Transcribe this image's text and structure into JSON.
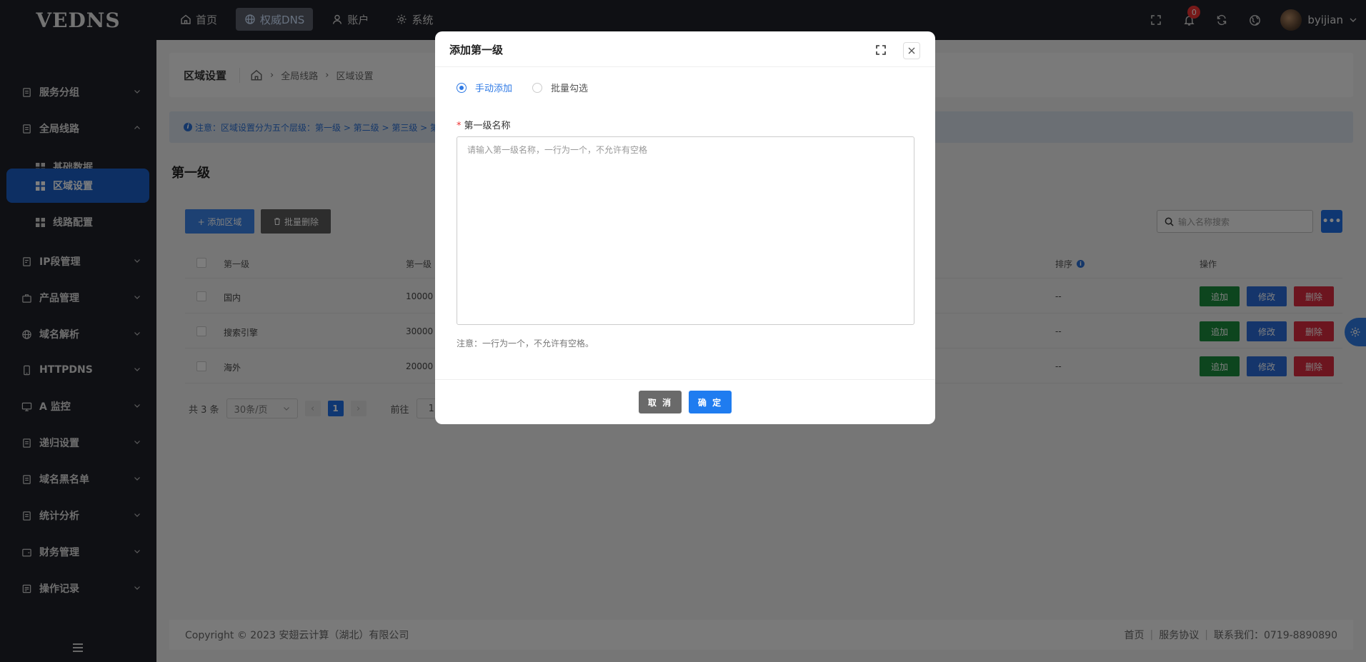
{
  "app": {
    "logo": "VEDNS"
  },
  "topnav": [
    {
      "label": "首页",
      "icon": "home-icon"
    },
    {
      "label": "权威DNS",
      "icon": "globe-icon",
      "active": true
    },
    {
      "label": "账户",
      "icon": "user-icon"
    },
    {
      "label": "系统",
      "icon": "gear-icon"
    }
  ],
  "header": {
    "notification_count": "0",
    "username": "byijian"
  },
  "sidebar": {
    "items": [
      {
        "label": "服务分组"
      },
      {
        "label": "全局线路",
        "expanded": true
      },
      {
        "label": "IP段管理"
      },
      {
        "label": "产品管理"
      },
      {
        "label": "域名解析"
      },
      {
        "label": "HTTPDNS"
      },
      {
        "label": "A 监控"
      },
      {
        "label": "递归设置"
      },
      {
        "label": "域名黑名单"
      },
      {
        "label": "统计分析"
      },
      {
        "label": "财务管理"
      },
      {
        "label": "操作记录"
      }
    ],
    "subitems": [
      {
        "label": "基础数据"
      },
      {
        "label": "区域设置",
        "active": true
      },
      {
        "label": "线路配置"
      }
    ]
  },
  "breadcrumb": {
    "title": "区域设置",
    "crumbs": [
      "全局线路",
      "区域设置"
    ]
  },
  "notice": {
    "text": "注意：区域设置分为五个层级：第一级 > 第二级 > 第三级 > 第"
  },
  "section": {
    "title": "第一级"
  },
  "toolbar": {
    "add_label": "+ 添加区域",
    "batch_delete_label": "批量删除",
    "search_placeholder": "输入名称搜索",
    "more_label": "•••"
  },
  "table": {
    "columns": [
      "第一级",
      "第一级",
      "排序",
      "操作"
    ],
    "rows": [
      {
        "name": "国内",
        "code": "10000",
        "order": "--"
      },
      {
        "name": "搜索引擎",
        "code": "30000",
        "order": "--"
      },
      {
        "name": "海外",
        "code": "20000",
        "order": "--"
      }
    ],
    "actions": {
      "add": "追加",
      "edit": "修改",
      "delete": "删除"
    }
  },
  "pager": {
    "total": "共 3 条",
    "page_size": "30条/页",
    "current": "1",
    "goto_label": "前往",
    "goto_value": "1"
  },
  "footer": {
    "copyright": "Copyright © 2023 安翅云计算（湖北）有限公司",
    "links": [
      "首页",
      "服务协议",
      "联系我们：0719-8890890"
    ]
  },
  "modal": {
    "title": "添加第一级",
    "radio_manual": "手动添加",
    "radio_batch": "批量勾选",
    "field_label": "第一级名称",
    "placeholder": "请输入第一级名称，一行为一个，不允许有空格",
    "tip": "注意：一行为一个，不允许有空格。",
    "cancel": "取 消",
    "confirm": "确 定"
  },
  "colors": {
    "accent": "#1f7cf0",
    "sidebar_bg": "#1f2029",
    "danger": "#d92b3e",
    "success": "#1b8b3c"
  }
}
